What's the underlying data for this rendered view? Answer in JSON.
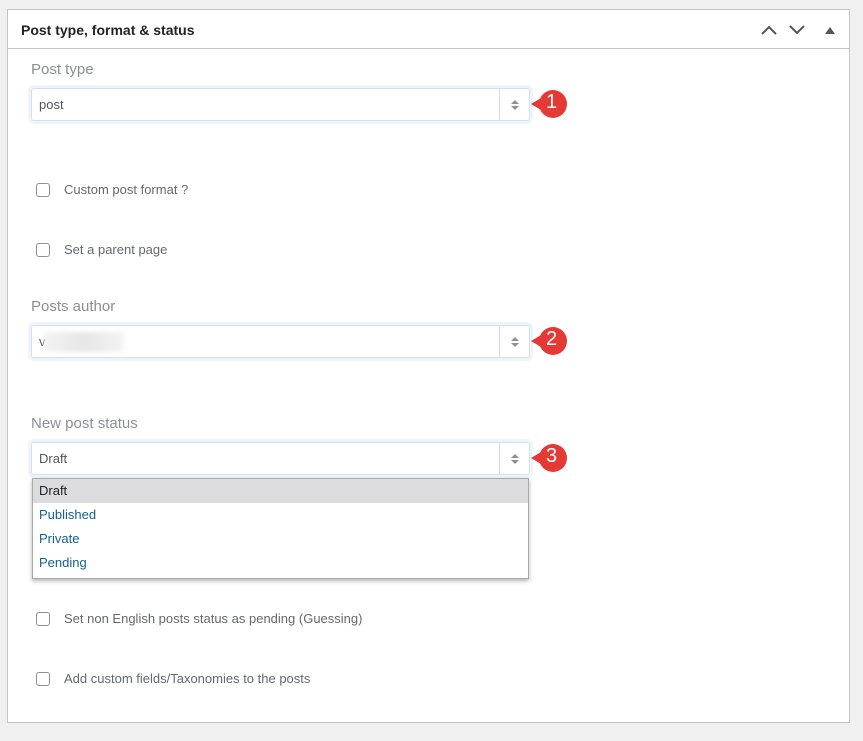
{
  "panel": {
    "title": "Post type, format & status",
    "controls": [
      "move-up",
      "move-down",
      "collapse"
    ]
  },
  "post_type": {
    "label": "Post type",
    "value": "post",
    "annotation": "1"
  },
  "checkboxes_top": [
    {
      "label": "Custom post format ?",
      "checked": false
    },
    {
      "label": "Set a parent page",
      "checked": false
    }
  ],
  "posts_author": {
    "label": "Posts author",
    "value_visible": "v",
    "annotation": "2"
  },
  "new_post_status": {
    "label": "New post status",
    "value": "Draft",
    "annotation": "3",
    "options": [
      {
        "label": "Draft",
        "selected": true
      },
      {
        "label": "Published",
        "selected": false
      },
      {
        "label": "Private",
        "selected": false
      },
      {
        "label": "Pending",
        "selected": false
      }
    ]
  },
  "checkboxes_bottom": [
    {
      "label": "Set non English posts status as pending (Guessing)",
      "checked": false
    },
    {
      "label": "Add custom fields/Taxonomies to the posts",
      "checked": false
    }
  ],
  "colors": {
    "annotation_badge": "#e53935",
    "link": "#135e96",
    "border": "#c3c4c7"
  }
}
